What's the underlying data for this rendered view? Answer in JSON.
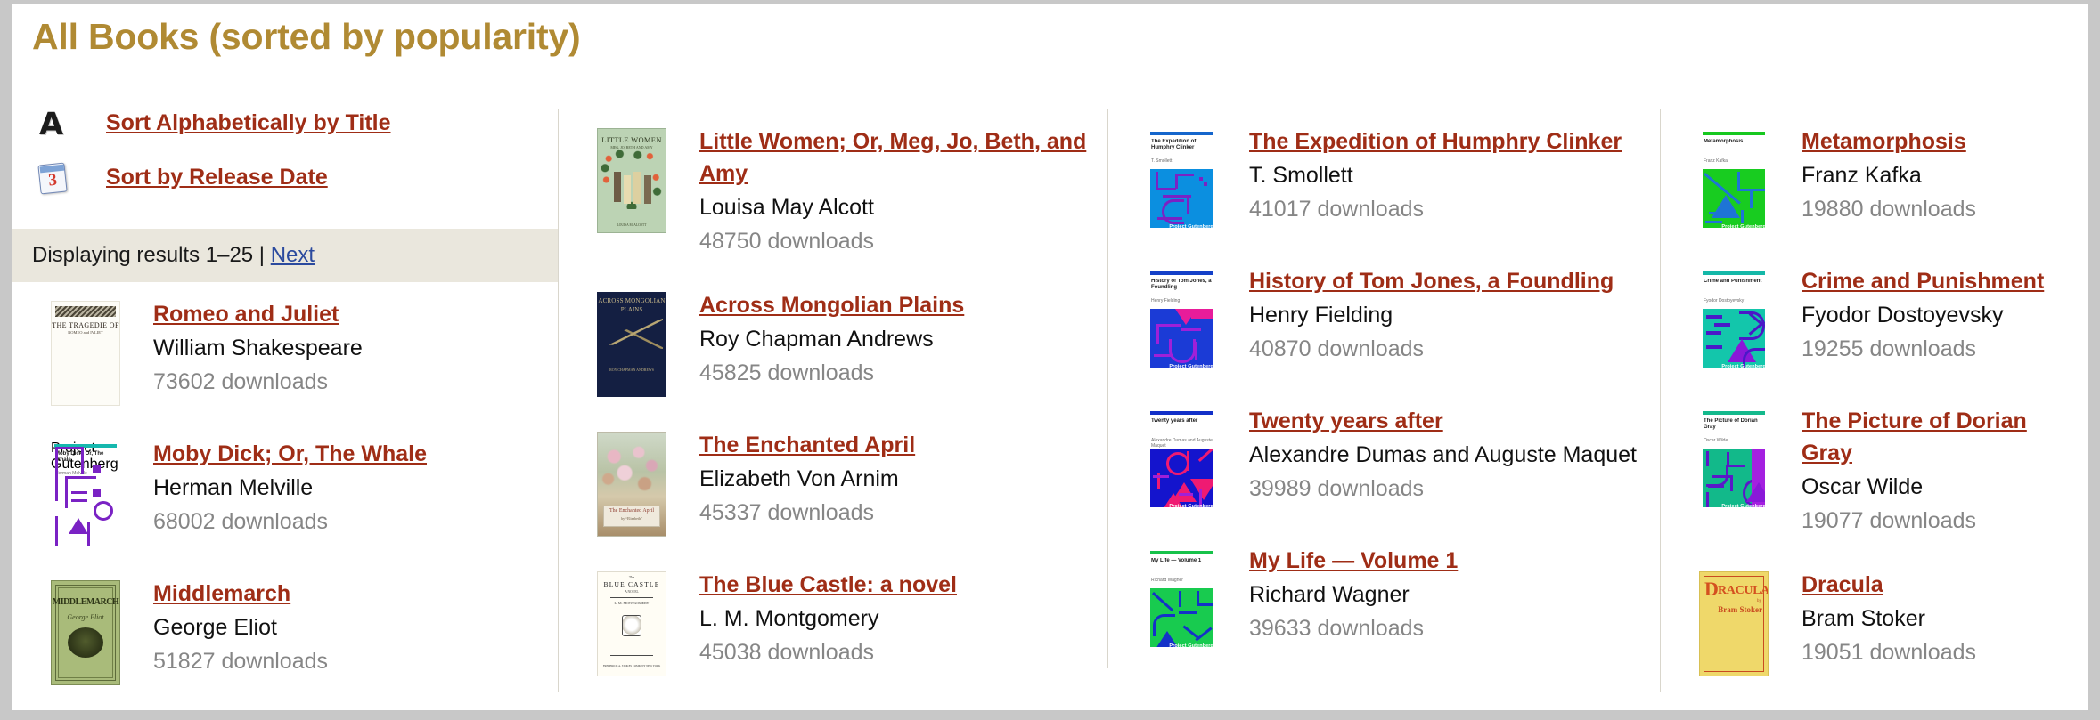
{
  "page": {
    "title": "All Books (sorted by popularity)",
    "title_color": "#b08a33"
  },
  "sort_options": [
    {
      "icon": "letter-a-icon",
      "label": "Sort Alphabetically by Title"
    },
    {
      "icon": "calendar-icon",
      "label": "Sort by Release Date",
      "calendar_day": "3"
    }
  ],
  "results_bar": {
    "text": "Displaying results 1–25 | ",
    "next_label": "Next"
  },
  "columns": [
    {
      "books": [
        {
          "title": "Romeo and Juliet",
          "author": "William Shakespeare",
          "downloads": "73602 downloads",
          "cover": "romeo"
        },
        {
          "title": "Moby Dick; Or, The Whale",
          "author": "Herman Melville",
          "downloads": "68002 downloads",
          "cover": "moby"
        },
        {
          "title": "Middlemarch",
          "author": "George Eliot",
          "downloads": "51827 downloads",
          "cover": "middlemarch"
        }
      ]
    },
    {
      "books": [
        {
          "title": "Little Women; Or, Meg, Jo, Beth, and Amy",
          "author": "Louisa May Alcott",
          "downloads": "48750 downloads",
          "cover": "littlewomen"
        },
        {
          "title": "Across Mongolian Plains",
          "author": "Roy Chapman Andrews",
          "downloads": "45825 downloads",
          "cover": "mongolian"
        },
        {
          "title": "The Enchanted April",
          "author": "Elizabeth Von Arnim",
          "downloads": "45337 downloads",
          "cover": "enchanted"
        },
        {
          "title": "The Blue Castle: a novel",
          "author": "L. M. Montgomery",
          "downloads": "45038 downloads",
          "cover": "bluecastle"
        }
      ]
    },
    {
      "books": [
        {
          "title": "The Expedition of Humphry Clinker",
          "author": "T. Smollett",
          "downloads": "41017 downloads",
          "cover": "pg-humphry"
        },
        {
          "title": "History of Tom Jones, a Foundling",
          "author": "Henry Fielding",
          "downloads": "40870 downloads",
          "cover": "pg-tomjones"
        },
        {
          "title": "Twenty years after",
          "author": "Alexandre Dumas and Auguste Maquet",
          "downloads": "39989 downloads",
          "cover": "pg-twenty"
        },
        {
          "title": "My Life — Volume 1",
          "author": "Richard Wagner",
          "downloads": "39633 downloads",
          "cover": "pg-mylife"
        }
      ]
    },
    {
      "books": [
        {
          "title": "Metamorphosis",
          "author": "Franz Kafka",
          "downloads": "19880 downloads",
          "cover": "pg-metamorphosis"
        },
        {
          "title": "Crime and Punishment",
          "author": "Fyodor Dostoyevsky",
          "downloads": "19255 downloads",
          "cover": "pg-crime"
        },
        {
          "title": "The Picture of Dorian Gray",
          "author": "Oscar Wilde",
          "downloads": "19077 downloads",
          "cover": "pg-dorian"
        },
        {
          "title": "Dracula",
          "author": "Bram Stoker",
          "downloads": "19051 downloads",
          "cover": "dracula"
        }
      ]
    }
  ],
  "cover_art": {
    "romeo": {
      "line1": "THE TRAGEDIE OF",
      "line2": "ROMEO and IVLIET"
    },
    "moby": {
      "title": "Moby Dick; Or, The Whale",
      "author": "Herman Melville",
      "accent": "#16b8ae",
      "bg": "#17c4bb",
      "ink": "#7a22c4",
      "pg_label": "Project Gutenberg"
    },
    "middlemarch": {
      "title": "MIDDLEMARCH",
      "author": "George Eliot"
    },
    "littlewomen": {
      "head": "LITTLE WOMEN",
      "sub": "MEG, JO, BETH AND AMY",
      "foot": "LOUISA M. ALCOTT"
    },
    "mongolian": {
      "line1": "ACROSS MONGOLIAN",
      "line2": "PLAINS",
      "foot": "ROY CHAPMAN ANDREWS"
    },
    "enchanted": {
      "t1": "The Enchanted April",
      "t2": "by “Elizabeth”"
    },
    "bluecastle": {
      "t0": "The",
      "t1": "BLUE  CASTLE",
      "t2": "A NOVEL",
      "t3": "L. M. MONTGOMERY",
      "t4": "FREDERICK A. STOKES COMPANY\nNEW YORK"
    },
    "dracula": {
      "first": "D",
      "rest": "RACULA",
      "by": "by",
      "author": "Bram Stoker"
    },
    "pg-humphry": {
      "title": "The Expedition of Humphry Clinker",
      "author": "T. Smollett",
      "accent": "#1566cc",
      "bg": "#0b8fe0",
      "ink": "#7a22c4",
      "pg_label": "Project Gutenberg"
    },
    "pg-tomjones": {
      "title": "History of Tom Jones, a Foundling",
      "author": "Henry Fielding",
      "accent": "#1440c8",
      "bg": "#1b3bd6",
      "ink": "#e81c9a",
      "pg_label": "Project Gutenberg"
    },
    "pg-twenty": {
      "title": "Twenty years after",
      "author": "Alexandre Dumas and Auguste Maquet",
      "accent": "#1230c8",
      "bg": "#1414cd",
      "ink": "#ef1a72",
      "pg_label": "Project Gutenberg"
    },
    "pg-mylife": {
      "title": "My Life — Volume 1",
      "author": "Richard Wagner",
      "accent": "#17c24a",
      "bg": "#18cb4f",
      "ink": "#1432c8",
      "pg_label": "Project Gutenberg"
    },
    "pg-metamorphosis": {
      "title": "Metamorphosis",
      "author": "Franz Kafka",
      "accent": "#17c81f",
      "bg": "#18cc20",
      "ink": "#1e74d6",
      "pg_label": "Project Gutenberg"
    },
    "pg-crime": {
      "title": "Crime and Punishment",
      "author": "Fyodor Dostoyevsky",
      "accent": "#14b8a8",
      "bg": "#13c6ab",
      "ink": "#7a18c8",
      "pg_label": "Project Gutenberg"
    },
    "pg-dorian": {
      "title": "The Picture of Dorian Gray",
      "author": "Oscar Wilde",
      "accent": "#14b98c",
      "bg": "#12b98a",
      "ink": "#7a18c8",
      "pg_label": "Project Gutenberg"
    }
  }
}
